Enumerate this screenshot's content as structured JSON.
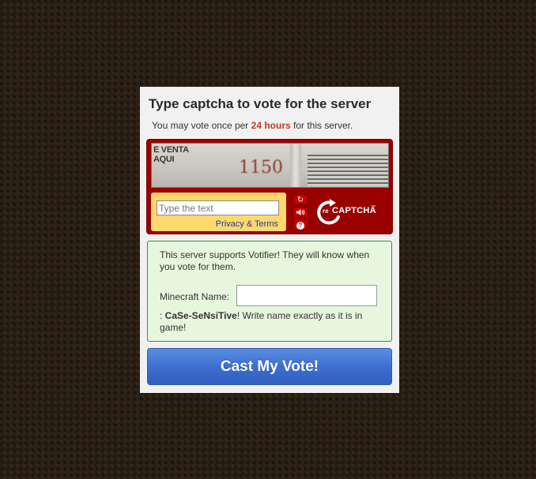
{
  "vote": {
    "title": "Type captcha to vote for the server",
    "subtitle_pre": "You may vote once per ",
    "subtitle_highlight": "24 hours",
    "subtitle_post": " for this server."
  },
  "captcha": {
    "image_text_sign": "E VENTA\nAQUI",
    "image_text_number": "1150",
    "input_placeholder": "Type the text",
    "privacy_link": "Privacy & Terms",
    "tools": [
      {
        "name": "refresh-icon",
        "glyph": "↻"
      },
      {
        "name": "audio-icon",
        "glyph": "🔊"
      },
      {
        "name": "help-icon",
        "glyph": "?"
      }
    ],
    "logo_prefix": "re",
    "logo_text": "CAPTCHA",
    "logo_tm": "™"
  },
  "votifier": {
    "info": "This server supports Votifier! They will know when you vote for them.",
    "name_label": "Minecraft Name:",
    "name_value": "",
    "warning_pre": ": ",
    "warning_bold": "CaSe-SeNsiTive",
    "warning_post": "! Write name exactly as it is in game!"
  },
  "submit": {
    "label": "Cast My Vote!"
  },
  "colors": {
    "captcha_bg": "#990000",
    "captcha_input_bg": "#ffd86e",
    "votifier_bg": "#e6f7dd",
    "votifier_border": "#3f8a45",
    "button": "#3d6fd0",
    "highlight": "#c0392b"
  }
}
